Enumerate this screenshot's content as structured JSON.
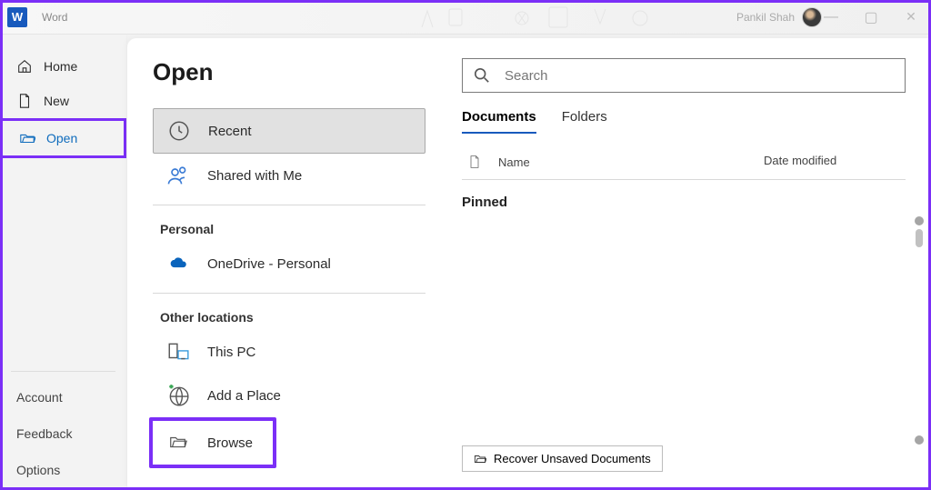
{
  "app": {
    "name": "Word",
    "user": "Pankil Shah"
  },
  "nav": {
    "home": "Home",
    "new": "New",
    "open": "Open",
    "account": "Account",
    "feedback": "Feedback",
    "options": "Options"
  },
  "page": {
    "title": "Open"
  },
  "locations": {
    "recent": "Recent",
    "shared": "Shared with Me",
    "personal_heading": "Personal",
    "onedrive": "OneDrive - Personal",
    "other_heading": "Other locations",
    "thispc": "This PC",
    "addplace": "Add a Place",
    "browse": "Browse"
  },
  "search": {
    "placeholder": "Search"
  },
  "tabs": {
    "documents": "Documents",
    "folders": "Folders"
  },
  "columns": {
    "name": "Name",
    "modified": "Date modified"
  },
  "sections": {
    "pinned": "Pinned"
  },
  "recover": "Recover Unsaved Documents"
}
